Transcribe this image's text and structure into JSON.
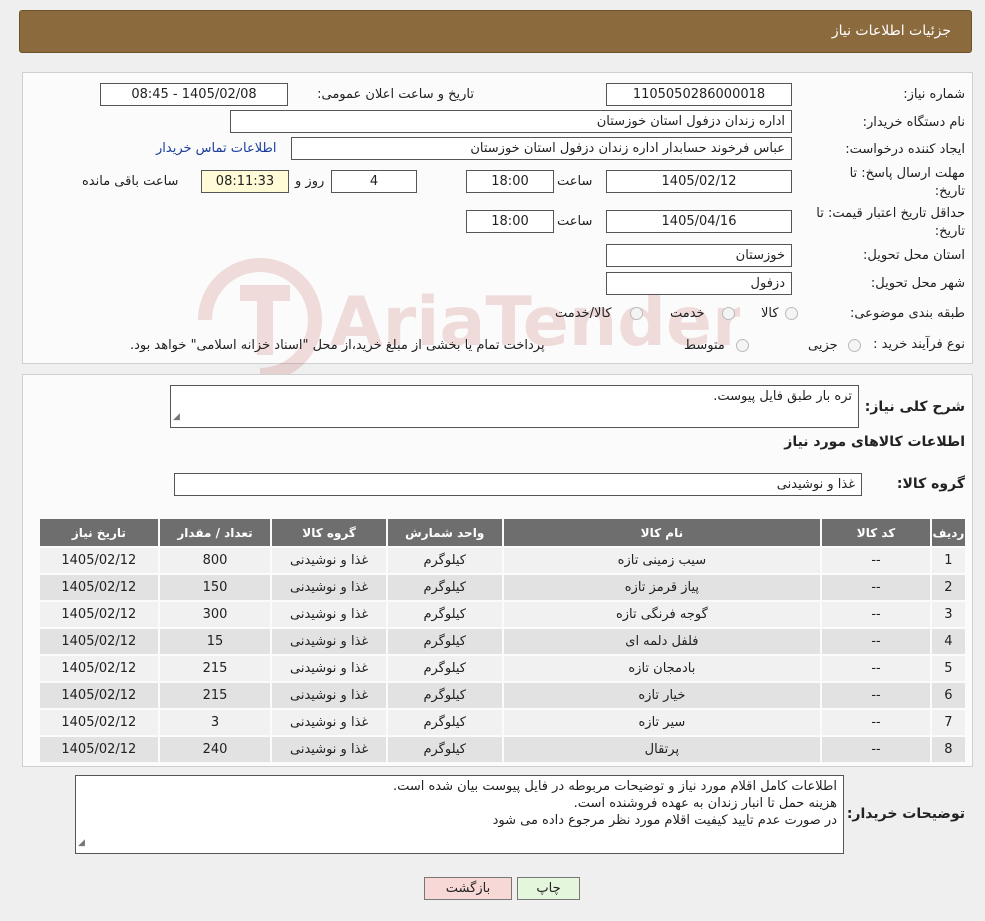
{
  "header": {
    "title": "جزئیات اطلاعات نیاز"
  },
  "form": {
    "need_number_label": "شماره نیاز:",
    "need_number": "1105050286000018",
    "announce_label": "تاریخ و ساعت اعلان عمومی:",
    "announce_value": "1405/02/08 - 08:45",
    "buyer_org_label": "نام دستگاه خریدار:",
    "buyer_org": "اداره زندان دزفول استان خوزستان",
    "creator_label": "ایجاد کننده درخواست:",
    "creator": "عباس فرخوند حسابدار اداره زندان دزفول استان خوزستان",
    "contact_link": "اطلاعات تماس خریدار",
    "deadline_label_1": "مهلت ارسال پاسخ: تا",
    "deadline_label_2": "تاریخ:",
    "deadline_date": "1405/02/12",
    "time_label": "ساعت",
    "deadline_time": "18:00",
    "days_value": "4",
    "days_label": "روز و",
    "remaining_time": "08:11:33",
    "remaining_label": "ساعت باقی مانده",
    "validity_label_1": "حداقل تاریخ اعتبار قیمت: تا",
    "validity_label_2": "تاریخ:",
    "validity_date": "1405/04/16",
    "validity_time": "18:00",
    "province_label": "استان محل تحویل:",
    "province": "خوزستان",
    "city_label": "شهر محل تحویل:",
    "city": "دزفول",
    "category_label": "طبقه بندی موضوعی:",
    "category_options": [
      "کالا",
      "خدمت",
      "کالا/خدمت"
    ],
    "process_label": "نوع فرآیند خرید :",
    "process_options": [
      "جزیی",
      "متوسط"
    ],
    "process_note": "پرداخت تمام یا بخشی از مبلغ خرید،از محل \"اسناد خزانه اسلامی\" خواهد بود."
  },
  "summary": {
    "label": "شرح کلی نیاز:",
    "value": "تره بار طبق فایل پیوست.",
    "goods_info_title": "اطلاعات کالاهای مورد نیاز",
    "group_label": "گروه کالا:",
    "group_value": "غذا و نوشیدنی"
  },
  "table": {
    "headers": [
      "ردیف",
      "کد کالا",
      "نام کالا",
      "واحد شمارش",
      "گروه کالا",
      "تعداد / مقدار",
      "تاریخ نیاز"
    ],
    "rows": [
      [
        "1",
        "--",
        "سیب زمینی تازه",
        "کیلوگرم",
        "غذا و نوشیدنی",
        "800",
        "1405/02/12"
      ],
      [
        "2",
        "--",
        "پیاز قرمز تازه",
        "کیلوگرم",
        "غذا و نوشیدنی",
        "150",
        "1405/02/12"
      ],
      [
        "3",
        "--",
        "گوجه فرنگی تازه",
        "کیلوگرم",
        "غذا و نوشیدنی",
        "300",
        "1405/02/12"
      ],
      [
        "4",
        "--",
        "فلفل دلمه ای",
        "کیلوگرم",
        "غذا و نوشیدنی",
        "15",
        "1405/02/12"
      ],
      [
        "5",
        "--",
        "بادمجان تازه",
        "کیلوگرم",
        "غذا و نوشیدنی",
        "215",
        "1405/02/12"
      ],
      [
        "6",
        "--",
        "خیار تازه",
        "کیلوگرم",
        "غذا و نوشیدنی",
        "215",
        "1405/02/12"
      ],
      [
        "7",
        "--",
        "سیر تازه",
        "کیلوگرم",
        "غذا و نوشیدنی",
        "3",
        "1405/02/12"
      ],
      [
        "8",
        "--",
        "پرتقال",
        "کیلوگرم",
        "غذا و نوشیدنی",
        "240",
        "1405/02/12"
      ]
    ]
  },
  "buyer_notes": {
    "label": "توضیحات خریدار:",
    "lines": [
      "اطلاعات کامل اقلام مورد نیاز و توضیحات مربوطه در فایل پیوست بیان شده است.",
      "هزینه حمل تا انبار زندان به عهده فروشنده است.",
      "در صورت عدم تایید کیفیت اقلام مورد نظر مرجوع داده می شود"
    ]
  },
  "buttons": {
    "print": "چاپ",
    "back": "بازگشت"
  },
  "watermark": {
    "text": "AriaTender.neT"
  },
  "colors": {
    "header_bg": "#8b6b3d",
    "table_header": "#6e6e6e",
    "back_button": "#f8d7d7",
    "print_button": "#e4f6dc"
  }
}
